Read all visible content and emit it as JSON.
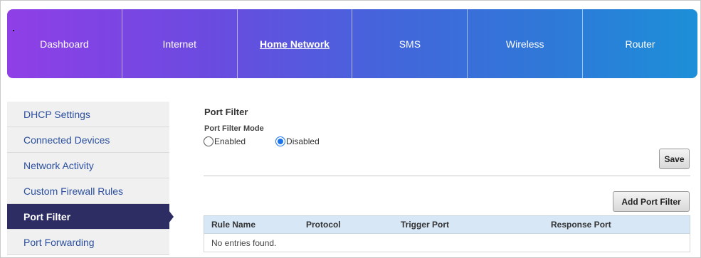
{
  "topnav": {
    "items": [
      {
        "label": "Dashboard"
      },
      {
        "label": "Internet"
      },
      {
        "label": "Home Network",
        "active": true
      },
      {
        "label": "SMS"
      },
      {
        "label": "Wireless"
      },
      {
        "label": "Router"
      }
    ]
  },
  "sidebar": {
    "items": [
      {
        "label": "DHCP Settings"
      },
      {
        "label": "Connected Devices"
      },
      {
        "label": "Network Activity"
      },
      {
        "label": "Custom Firewall Rules"
      },
      {
        "label": "Port Filter",
        "active": true
      },
      {
        "label": "Port Forwarding"
      }
    ]
  },
  "main": {
    "title": "Port Filter",
    "mode_label": "Port Filter Mode",
    "mode_options": [
      {
        "label": "Enabled",
        "checked": false
      },
      {
        "label": "Disabled",
        "checked": true
      }
    ],
    "save_label": "Save",
    "add_label": "Add Port Filter",
    "table": {
      "columns": [
        "Rule Name",
        "Protocol",
        "Trigger Port",
        "Response Port"
      ],
      "empty_text": "No entries found."
    }
  },
  "colors": {
    "nav_gradient_start": "#8f3fe6",
    "nav_gradient_end": "#1d8fd8",
    "sidebar_active": "#2d2c63",
    "sidebar_link": "#2b4f9e",
    "table_header": "#d7e7f6",
    "radio_checked": "#1a73e8"
  }
}
